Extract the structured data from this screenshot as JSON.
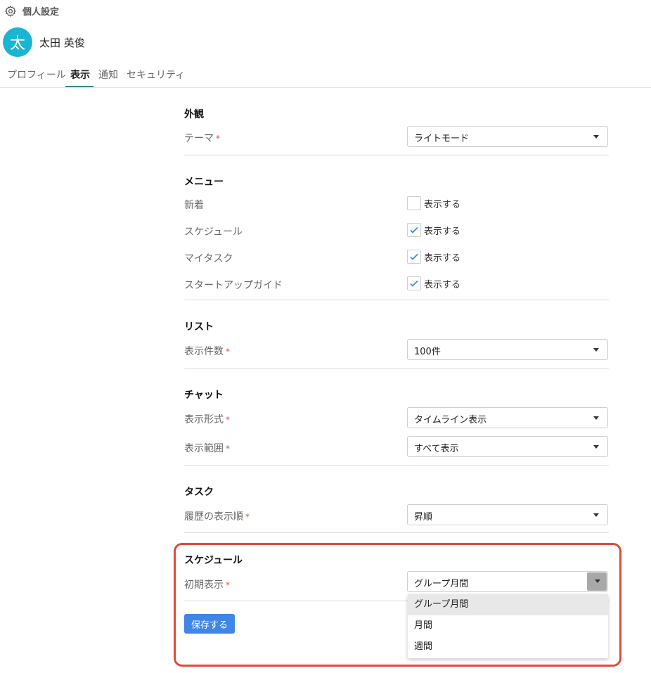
{
  "header": {
    "title": "個人設定"
  },
  "user": {
    "avatar_char": "太",
    "name": "太田 英俊"
  },
  "tabs": [
    "プロフィール",
    "表示",
    "通知",
    "セキュリティ"
  ],
  "sections": {
    "appearance": {
      "title": "外観",
      "theme_label": "テーマ",
      "theme_value": "ライトモード"
    },
    "menu": {
      "title": "メニュー",
      "items": [
        {
          "label": "新着",
          "checked": false,
          "check_label": "表示する"
        },
        {
          "label": "スケジュール",
          "checked": true,
          "check_label": "表示する"
        },
        {
          "label": "マイタスク",
          "checked": true,
          "check_label": "表示する"
        },
        {
          "label": "スタートアップガイド",
          "checked": true,
          "check_label": "表示する"
        }
      ]
    },
    "list": {
      "title": "リスト",
      "count_label": "表示件数",
      "count_value": "100件"
    },
    "chat": {
      "title": "チャット",
      "format_label": "表示形式",
      "format_value": "タイムライン表示",
      "range_label": "表示範囲",
      "range_value": "すべて表示"
    },
    "task": {
      "title": "タスク",
      "history_label": "履歴の表示順",
      "history_value": "昇順"
    },
    "schedule": {
      "title": "スケジュール",
      "initial_label": "初期表示",
      "initial_value": "グループ月間",
      "options": [
        "グループ月間",
        "月間",
        "週間"
      ]
    }
  },
  "required_mark": "*",
  "save_label": "保存する",
  "colors": {
    "accent": "#19b5d3",
    "button": "#3f86e6",
    "highlight": "#e04a3b",
    "required": "#e05050"
  }
}
